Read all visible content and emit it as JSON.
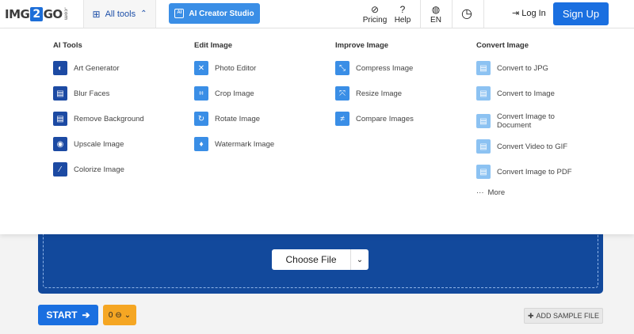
{
  "header": {
    "logo": {
      "left": "IMG",
      "mid": "2",
      "right": "GO",
      "com": ".com"
    },
    "all_tools": "All tools",
    "creator_studio": "AI Creator Studio",
    "pricing": "Pricing",
    "help": "Help",
    "language": "EN",
    "login": "Log In",
    "signup": "Sign Up"
  },
  "menu": {
    "ai_tools": {
      "title": "AI Tools",
      "items": [
        "Art Generator",
        "Blur Faces",
        "Remove Background",
        "Upscale Image",
        "Colorize Image"
      ]
    },
    "edit_image": {
      "title": "Edit Image",
      "items": [
        "Photo Editor",
        "Crop Image",
        "Rotate Image",
        "Watermark Image"
      ]
    },
    "improve_image": {
      "title": "Improve Image",
      "items": [
        "Compress Image",
        "Resize Image",
        "Compare Images"
      ]
    },
    "convert_image": {
      "title": "Convert Image",
      "items": [
        "Convert to JPG",
        "Convert to Image",
        "Convert Image to Document",
        "Convert Video to GIF",
        "Convert Image to PDF"
      ],
      "more": "More"
    }
  },
  "upload": {
    "choose_file": "Choose File"
  },
  "actions": {
    "start": "START",
    "credits": "0",
    "add_sample": "ADD SAMPLE FILE"
  },
  "colors": {
    "brand_blue": "#1a6fe0",
    "dropzone": "#12499c",
    "credit_orange": "#f5a623"
  }
}
